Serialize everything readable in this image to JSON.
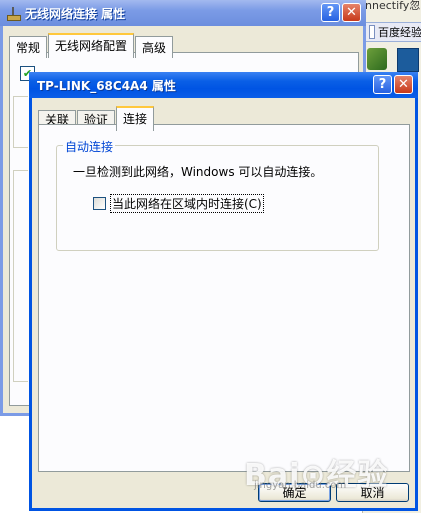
{
  "background_app": {
    "url_text": "nnectify忽",
    "favorite_text": "百度经验"
  },
  "back_window": {
    "title": "无线网络连接 属性",
    "help_glyph": "?",
    "close_glyph": "✕",
    "tabs": [
      {
        "label": "常规",
        "selected": false
      },
      {
        "label": "无线网络配置",
        "selected": true
      },
      {
        "label": "高级",
        "selected": false
      }
    ],
    "check_glyph": "✔"
  },
  "front_window": {
    "title": "TP-LINK_68C4A4 属性",
    "help_glyph": "?",
    "close_glyph": "✕",
    "tabs": [
      {
        "label": "关联",
        "selected": false
      },
      {
        "label": "验证",
        "selected": false
      },
      {
        "label": "连接",
        "selected": true
      }
    ],
    "group": {
      "legend": "自动连接",
      "description": "一旦检测到此网络，Windows 可以自动连接。",
      "checkbox_label": "当此网络在区域内时连接(C)",
      "checkbox_checked": false
    },
    "buttons": {
      "ok": "确定",
      "cancel": "取消"
    }
  },
  "watermark": {
    "text": "Bai⊙经验",
    "sub": "jingyan.baidu.com"
  },
  "colors": {
    "active_title": "#0054e3",
    "inactive_title": "#7b9be6",
    "dialog_face": "#ece9d8",
    "group_legend": "#0046d5"
  }
}
